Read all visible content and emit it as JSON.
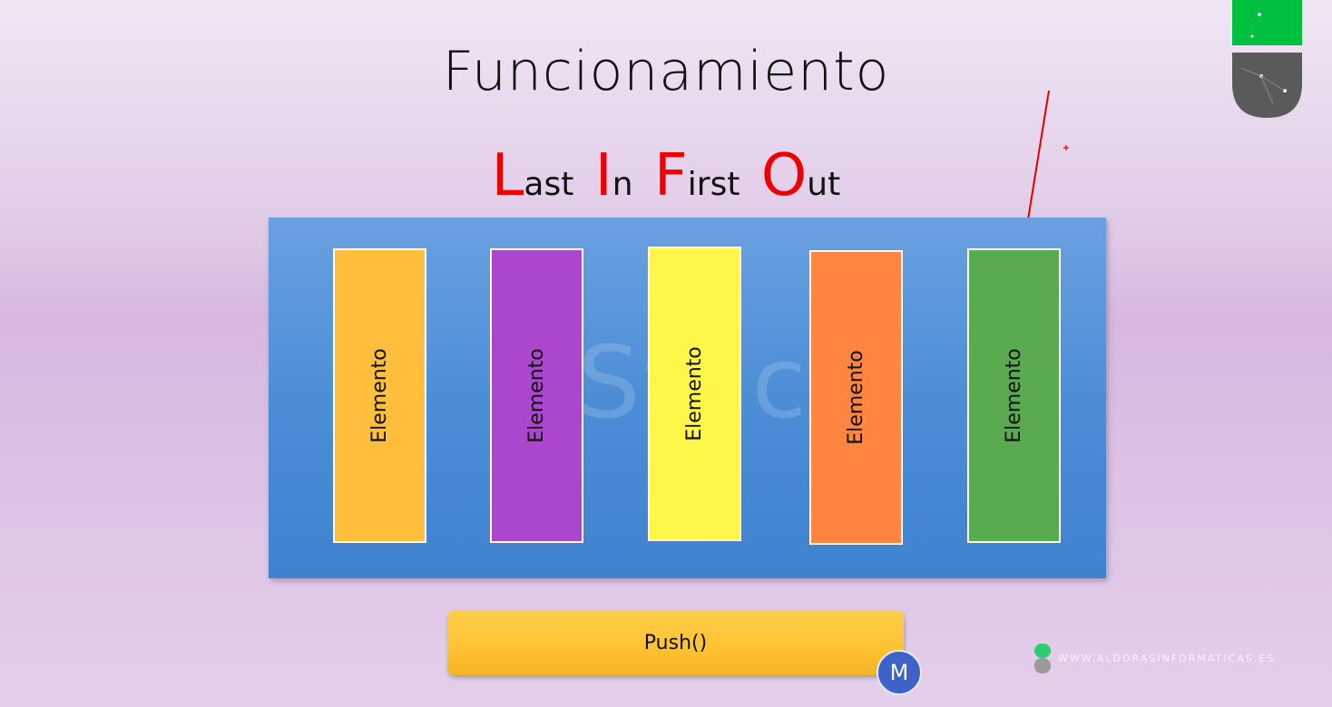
{
  "slide": {
    "title": "Funcionamiento",
    "lifo": [
      {
        "cap": "L",
        "rest": "ast"
      },
      {
        "cap": "I",
        "rest": "n"
      },
      {
        "cap": "F",
        "rest": "irst"
      },
      {
        "cap": "O",
        "rest": "ut"
      }
    ],
    "watermark": "Stack"
  },
  "stack": {
    "elements": [
      {
        "label": "Elemento",
        "color": "#ffbf3c"
      },
      {
        "label": "Elemento",
        "color": "#ab47cc"
      },
      {
        "label": "Elemento",
        "color": "#fff64a"
      },
      {
        "label": "Elemento",
        "color": "#ff8540"
      },
      {
        "label": "Elemento",
        "color": "#5aaa50"
      }
    ]
  },
  "controls": {
    "push_label": "Push()"
  },
  "avatar": {
    "initial": "M"
  },
  "brand": {
    "footer_text": "WWW.ALDORASINFORMATICAS.ES"
  },
  "colors": {
    "lifo_accent": "#ee0000",
    "stack_background": "#4c8ed6",
    "push_button": "#ffc234",
    "avatar": "#3f62c6",
    "logo_green": "#00c040",
    "logo_gray": "#5a5a5a",
    "annotation_arrow": "#e00000"
  },
  "icons": {
    "logo": "capsule-logo-icon",
    "annotation": "red-arrow-icon",
    "brand": "capsule-brand-icon"
  }
}
